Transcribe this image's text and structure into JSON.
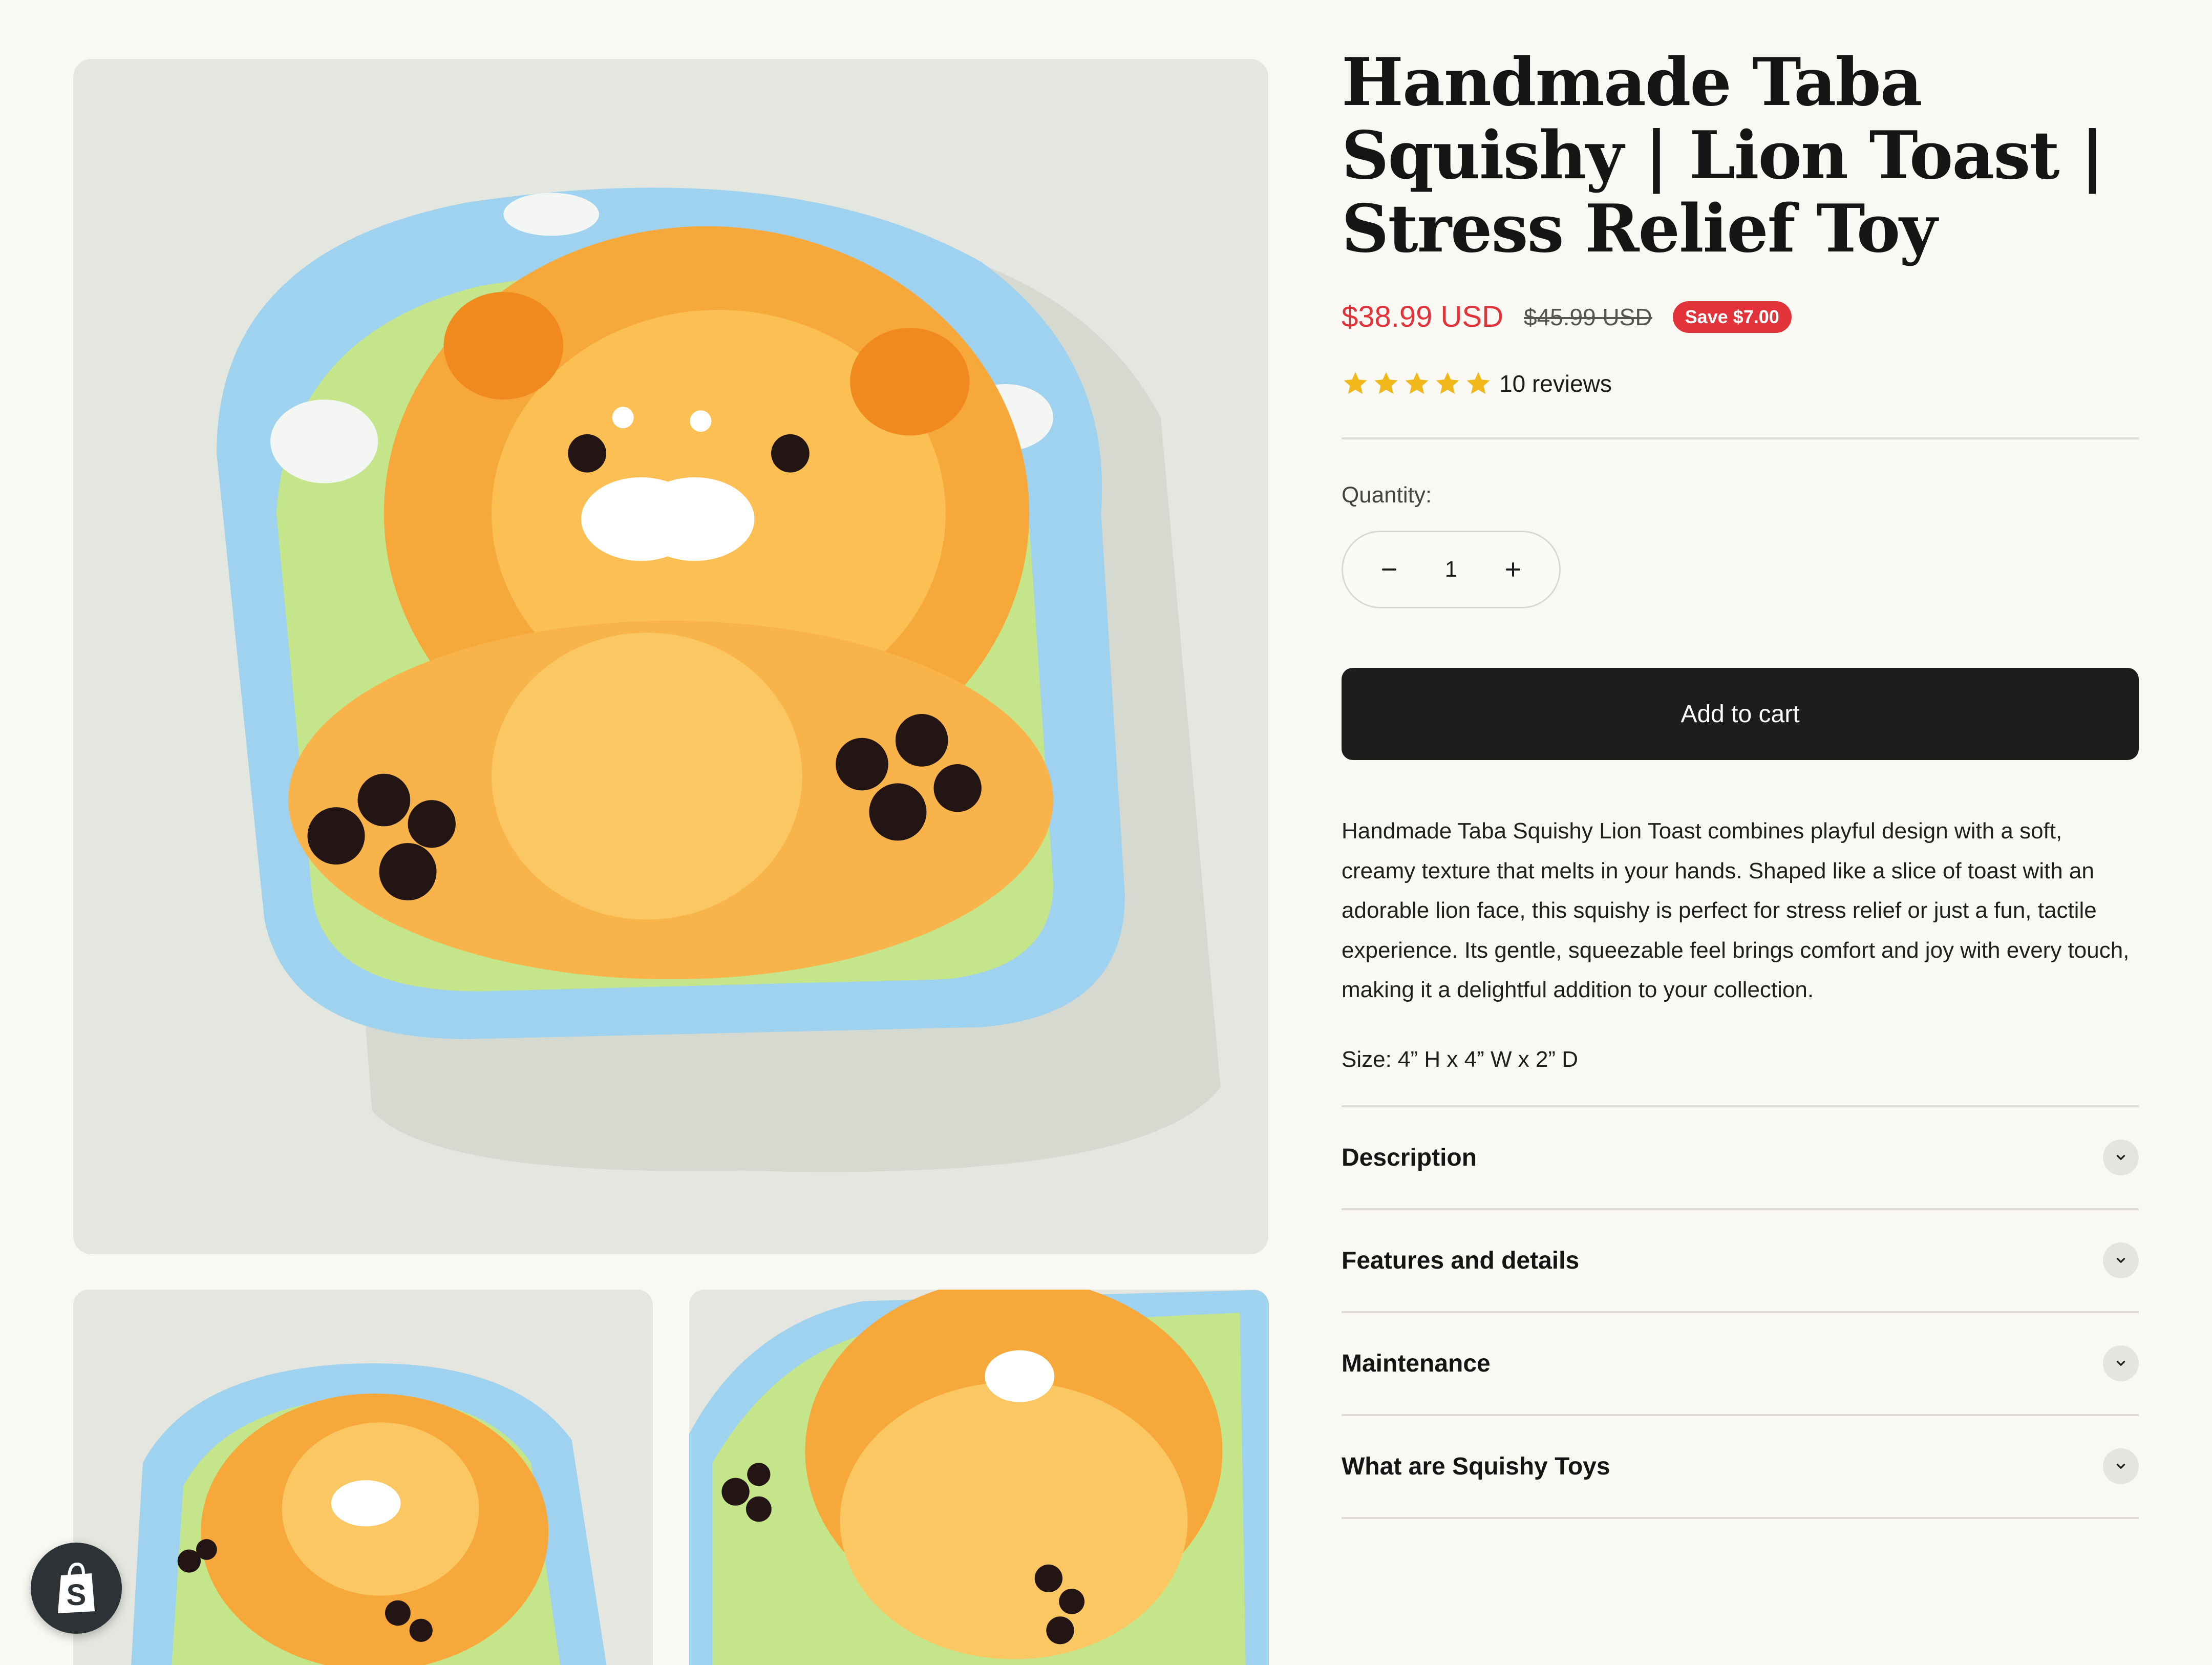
{
  "product": {
    "title": "Handmade Taba Squishy | Lion Toast | Stress Relief Toy",
    "price_sale": "$38.99 USD",
    "price_compare": "$45.99 USD",
    "save_badge": "Save $7.00",
    "rating_stars": 5,
    "reviews_label": "10 reviews",
    "quantity_label": "Quantity:",
    "quantity_value": "1",
    "add_to_cart_label": "Add to cart",
    "description": "Handmade Taba Squishy Lion Toast combines playful design with a soft, creamy texture that melts in your hands. Shaped like a slice of toast with an adorable lion face, this squishy is perfect for stress relief or just a fun, tactile experience. Its gentle, squeezable feel brings comfort and joy with every touch, making it a delightful addition to your collection.",
    "size": "Size: 4” H x 4” W x 2” D"
  },
  "accordion": [
    {
      "label": "Description"
    },
    {
      "label": "Features and details"
    },
    {
      "label": "Maintenance"
    },
    {
      "label": "What are Squishy Toys"
    }
  ],
  "colors": {
    "sale": "#e2333a",
    "star": "#f1b81c",
    "button": "#1d1d1d",
    "background": "#f9f8f3"
  },
  "icons": {
    "star": "star-icon",
    "minus": "minus-icon",
    "plus": "plus-icon",
    "chevron": "chevron-down-icon",
    "shop": "shopify-bag-icon"
  }
}
